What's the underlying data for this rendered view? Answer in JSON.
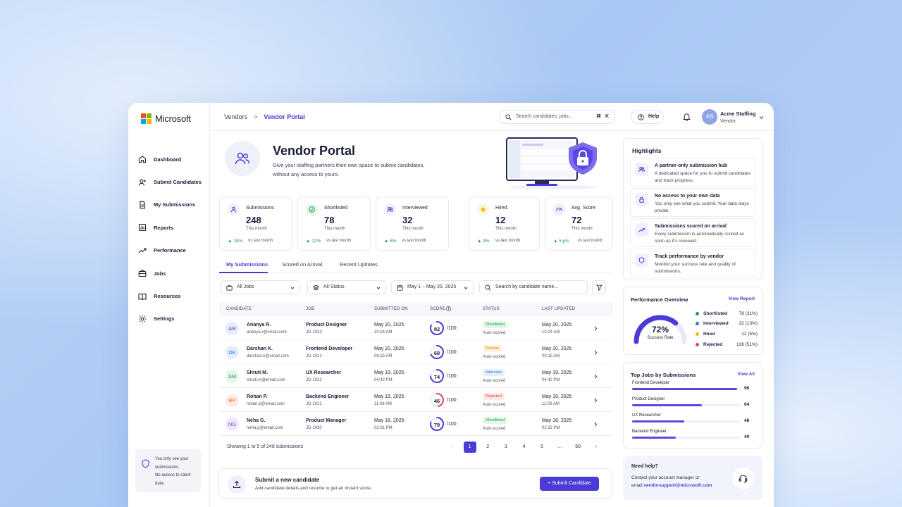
{
  "brand": {
    "name": "Microsoft",
    "colors": [
      "#f25022",
      "#7fba00",
      "#00a4ef",
      "#ffb900"
    ]
  },
  "sidebar": {
    "items": [
      {
        "label": "Dashboard",
        "icon": "home-icon"
      },
      {
        "label": "Submit Candidates",
        "icon": "add-user-icon"
      },
      {
        "label": "My Submissions",
        "icon": "document-icon"
      },
      {
        "label": "Reports",
        "icon": "bar-chart-icon"
      },
      {
        "label": "Performance",
        "icon": "trend-icon"
      },
      {
        "label": "Jobs",
        "icon": "briefcase-icon"
      },
      {
        "label": "Resources",
        "icon": "book-icon"
      },
      {
        "label": "Settings",
        "icon": "gear-icon"
      }
    ],
    "note": {
      "line1": "You only see your",
      "line2": "submissions.",
      "line3": "No access to client",
      "line4": "data."
    }
  },
  "topbar": {
    "breadcrumb": {
      "parent": "Vendors",
      "separator": ">",
      "current": "Vendor Portal"
    },
    "search_placeholder": "Search candidates, jobs...",
    "search_shortcut": "⌘ K",
    "help_label": "Help",
    "account": {
      "initials": "AS",
      "name": "Acme Staffing",
      "role": "Vendor"
    }
  },
  "hero": {
    "title": "Vendor Portal",
    "desc_line1": "Give your staffing partners their own space to submit candidates,",
    "desc_line2": "without any access to yours."
  },
  "stats": [
    {
      "label": "Submissions",
      "value": "248",
      "period": "This month",
      "delta": "▲ 18%",
      "vs": "vs last month",
      "icon": "user-icon"
    },
    {
      "label": "Shortlisted",
      "value": "78",
      "period": "This month",
      "delta": "▲ 12%",
      "vs": "vs last month",
      "icon": "check-circle-icon"
    },
    {
      "label": "Interviewed",
      "value": "32",
      "period": "This month",
      "delta": "▲ 6%",
      "vs": "vs last month",
      "icon": "users-icon"
    },
    {
      "label": "Hired",
      "value": "12",
      "period": "This month",
      "delta": "▲ 9%",
      "vs": "vs last month",
      "icon": "star-icon"
    },
    {
      "label": "Avg. Score",
      "value": "72",
      "period": "This month",
      "delta": "▲ 5 pts",
      "vs": "vs last month",
      "icon": "gauge-icon"
    }
  ],
  "tabs": [
    "My Submissions",
    "Scored on Arrival",
    "Recent Updates"
  ],
  "filters": {
    "jobs": "All Jobs",
    "status": "All Status",
    "date": "May 1 – May 20, 2025",
    "search_placeholder": "Search by candidate name..."
  },
  "table": {
    "headers": [
      "CANDIDATE",
      "JOB",
      "SUBMITTED ON",
      "SCORE",
      "STATUS",
      "LAST UPDATED"
    ],
    "score_suffix": "/100",
    "rows": [
      {
        "initials": "AR",
        "name": "Ananya R.",
        "email": "ananya.r@email.com",
        "job": "Product Designer",
        "job_id": "JD-1023",
        "submitted_date": "May 20, 2025",
        "submitted_time": "10:24 AM",
        "score": 82,
        "status": "Shortlisted",
        "auto": "Auto-scored",
        "updated_date": "May 20, 2025",
        "updated_time": "10:24 AM",
        "avatar_bg": "#e8ebfb",
        "avatar_fg": "#4b3bd6",
        "ring_color": "#4b3bd6",
        "badge_bg": "#e3f6ea",
        "badge_fg": "#1f9a4b"
      },
      {
        "initials": "DK",
        "name": "Darshan K.",
        "email": "darshan.k@email.com",
        "job": "Frontend Developer",
        "job_id": "JD-1021",
        "submitted_date": "May 20, 2025",
        "submitted_time": "09:15 AM",
        "score": 68,
        "status": "Review",
        "auto": "Auto-scored",
        "updated_date": "May 20, 2025",
        "updated_time": "09:15 AM",
        "avatar_bg": "#e3eefc",
        "avatar_fg": "#2f6fd6",
        "ring_color": "#4b3bd6",
        "badge_bg": "#fdf3dc",
        "badge_fg": "#c98a00"
      },
      {
        "initials": "SM",
        "name": "Shruti M.",
        "email": "shruti.m@email.com",
        "job": "UX Researcher",
        "job_id": "JD-1022",
        "submitted_date": "May 19, 2025",
        "submitted_time": "04:42 PM",
        "score": 74,
        "status": "Interview",
        "auto": "Auto-scored",
        "updated_date": "May 19, 2025",
        "updated_time": "04:43 PM",
        "avatar_bg": "#e3f6ea",
        "avatar_fg": "#1f9a4b",
        "ring_color": "#4b3bd6",
        "badge_bg": "#e6efff",
        "badge_fg": "#2f6fd6"
      },
      {
        "initials": "RP",
        "name": "Rohan P.",
        "email": "rohan.p@email.com",
        "job": "Backend Engineer",
        "job_id": "JD-1021",
        "submitted_date": "May 19, 2025",
        "submitted_time": "11:08 AM",
        "score": 46,
        "status": "Rejected",
        "auto": "Auto-scored",
        "updated_date": "May 19, 2025",
        "updated_time": "11:09 AM",
        "avatar_bg": "#fdece4",
        "avatar_fg": "#e06b2c",
        "ring_color": "#e5484d",
        "badge_bg": "#fde8e8",
        "badge_fg": "#d63b3b"
      },
      {
        "initials": "NG",
        "name": "Neha G.",
        "email": "neha.g@email.com",
        "job": "Product Manager",
        "job_id": "JD-1030",
        "submitted_date": "May 18, 2025",
        "submitted_time": "02:31 PM",
        "score": 79,
        "status": "Shortlisted",
        "auto": "Auto-scored",
        "updated_date": "May 18, 2025",
        "updated_time": "02:32 PM",
        "avatar_bg": "#efe8fb",
        "avatar_fg": "#7a4bd6",
        "ring_color": "#4b3bd6",
        "badge_bg": "#e3f6ea",
        "badge_fg": "#1f9a4b"
      }
    ],
    "footer": "Showing 1 to 5 of 248 submissions",
    "pages": [
      "‹",
      "1",
      "2",
      "3",
      "4",
      "5",
      "...",
      "50",
      "›"
    ],
    "active_page": "1"
  },
  "submit": {
    "title": "Submit a new candidate",
    "desc": "Add candidate details and resume to get an instant score.",
    "button": "+ Submit Candidate"
  },
  "highlights": {
    "title": "Highlights",
    "items": [
      {
        "title": "A partner-only submission hub",
        "desc": "A dedicated space for you to submit candidates and track progress.",
        "icon": "users-icon"
      },
      {
        "title": "No access to your own data",
        "desc": "You only see what you submit. Your data stays private.",
        "icon": "lock-icon"
      },
      {
        "title": "Submissions scored on arrival",
        "desc": "Every submission is automatically scored as soon as it's received.",
        "icon": "trend-icon"
      },
      {
        "title": "Track performance by vendor",
        "desc": "Monitor your success rate and quality of submissions.",
        "icon": "shield-icon"
      }
    ]
  },
  "performance": {
    "title": "Performance Overview",
    "link": "View Report",
    "success_rate": "72%",
    "success_value": 72,
    "success_label": "Success Rate",
    "legend": [
      {
        "name": "Shortlisted",
        "value": "78 (31%)",
        "color": "#1f9a4b"
      },
      {
        "name": "Interviewed",
        "value": "32 (13%)",
        "color": "#2f6fd6"
      },
      {
        "name": "Hired",
        "value": "12 (5%)",
        "color": "#f5b400"
      },
      {
        "name": "Rejected",
        "value": "126 (51%)",
        "color": "#e5484d"
      }
    ]
  },
  "top_jobs": {
    "title": "Top Jobs by Submissions",
    "link": "View All",
    "max": 100,
    "items": [
      {
        "name": "Frontend Developer",
        "value": 96
      },
      {
        "name": "Product Designer",
        "value": 64
      },
      {
        "name": "UX Researcher",
        "value": 48
      },
      {
        "name": "Backend Engineer",
        "value": 40
      }
    ]
  },
  "need_help": {
    "title": "Need help?",
    "line1": "Contact your account manager or",
    "email_prefix": "email ",
    "email": "vendorsupport@microsoft.com"
  },
  "colors": {
    "accent": "#4b3bd6",
    "positive": "#1f9a4b"
  }
}
